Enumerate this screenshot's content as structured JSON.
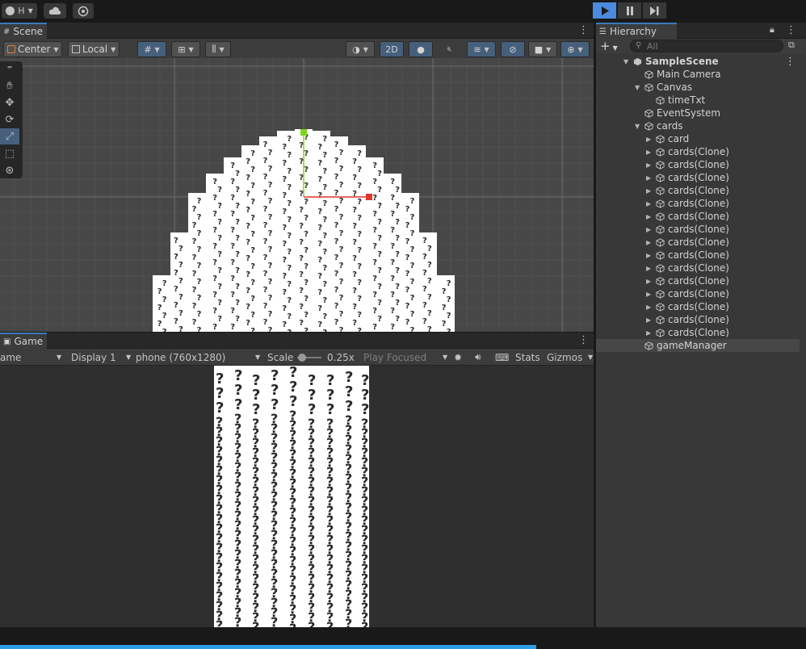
{
  "topbar": {
    "account_label": "H",
    "play_icon": "play-icon",
    "pause_icon": "pause-icon",
    "step_icon": "step-icon"
  },
  "scene": {
    "tab_label": "Scene",
    "pivot_label": "Center",
    "space_label": "Local",
    "mode_2d_label": "2D"
  },
  "game": {
    "tab_label": "Game",
    "view_label": "ame",
    "display_label": "Display 1",
    "resolution_label": "phone (760x1280)",
    "scale_label": "Scale",
    "scale_value": "0.25x",
    "play_mode_label": "Play Focused",
    "stats_label": "Stats",
    "gizmos_label": "Gizmos"
  },
  "hierarchy": {
    "tab_label": "Hierarchy",
    "search_placeholder": "All",
    "add_label": "+",
    "scene_name": "SampleScene",
    "items": [
      {
        "label": "Main Camera",
        "depth": 1,
        "expandable": false
      },
      {
        "label": "Canvas",
        "depth": 1,
        "expandable": true,
        "expanded": true
      },
      {
        "label": "timeTxt",
        "depth": 2,
        "expandable": false
      },
      {
        "label": "EventSystem",
        "depth": 1,
        "expandable": false
      },
      {
        "label": "cards",
        "depth": 1,
        "expandable": true,
        "expanded": true
      },
      {
        "label": "card",
        "depth": 2,
        "expandable": true,
        "expanded": false
      },
      {
        "label": "cards(Clone)",
        "depth": 2,
        "expandable": true,
        "expanded": false
      },
      {
        "label": "cards(Clone)",
        "depth": 2,
        "expandable": true,
        "expanded": false
      },
      {
        "label": "cards(Clone)",
        "depth": 2,
        "expandable": true,
        "expanded": false
      },
      {
        "label": "cards(Clone)",
        "depth": 2,
        "expandable": true,
        "expanded": false
      },
      {
        "label": "cards(Clone)",
        "depth": 2,
        "expandable": true,
        "expanded": false
      },
      {
        "label": "cards(Clone)",
        "depth": 2,
        "expandable": true,
        "expanded": false
      },
      {
        "label": "cards(Clone)",
        "depth": 2,
        "expandable": true,
        "expanded": false
      },
      {
        "label": "cards(Clone)",
        "depth": 2,
        "expandable": true,
        "expanded": false
      },
      {
        "label": "cards(Clone)",
        "depth": 2,
        "expandable": true,
        "expanded": false
      },
      {
        "label": "cards(Clone)",
        "depth": 2,
        "expandable": true,
        "expanded": false
      },
      {
        "label": "cards(Clone)",
        "depth": 2,
        "expandable": true,
        "expanded": false
      },
      {
        "label": "cards(Clone)",
        "depth": 2,
        "expandable": true,
        "expanded": false
      },
      {
        "label": "cards(Clone)",
        "depth": 2,
        "expandable": true,
        "expanded": false
      },
      {
        "label": "cards(Clone)",
        "depth": 2,
        "expandable": true,
        "expanded": false
      },
      {
        "label": "cards(Clone)",
        "depth": 2,
        "expandable": true,
        "expanded": false
      },
      {
        "label": "gameManager",
        "depth": 1,
        "expandable": false,
        "selected": true
      }
    ]
  },
  "card_glyph": "?",
  "colors": {
    "accent": "#3a79bb",
    "play_active": "#4a8be0",
    "gizmo_x": "#e0362c",
    "gizmo_y": "#7ed321"
  }
}
